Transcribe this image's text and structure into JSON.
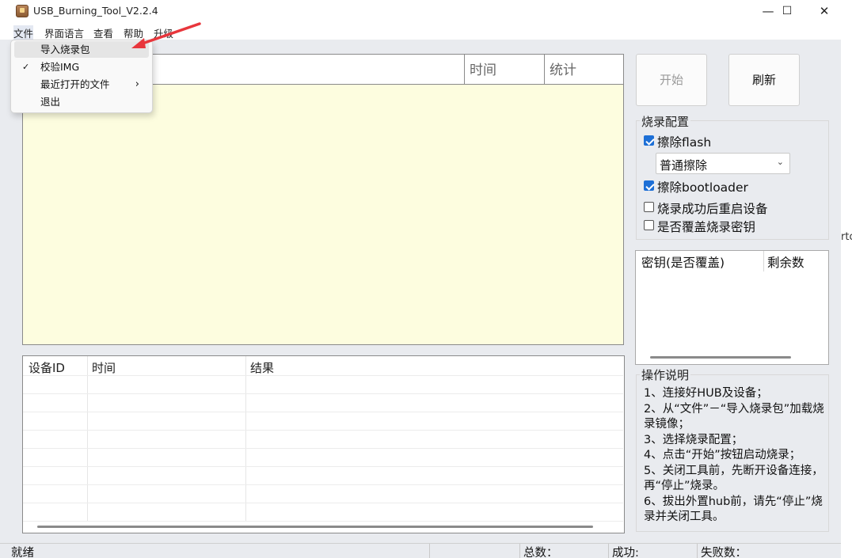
{
  "window": {
    "title": "USB_Burning_Tool_V2.2.4",
    "controls": [
      "—",
      "☐",
      "✕"
    ]
  },
  "menubar": {
    "items": [
      "文件",
      "界面语言",
      "查看",
      "帮助",
      "升级"
    ]
  },
  "file_menu": {
    "items": [
      {
        "label": "导入烧录包",
        "checked": false,
        "submenu": false
      },
      {
        "label": "校验IMG",
        "checked": true,
        "submenu": false
      },
      {
        "label": "最近打开的文件",
        "checked": false,
        "submenu": true
      },
      {
        "label": "退出",
        "checked": false,
        "submenu": false
      }
    ],
    "check_mark": "✓",
    "submenu_arrow": "›"
  },
  "log_panel": {
    "columns": [
      "时间",
      "统计"
    ]
  },
  "device_table": {
    "columns": [
      "设备ID",
      "时间",
      "结果"
    ]
  },
  "buttons": {
    "start": "开始",
    "refresh": "刷新"
  },
  "burn_config": {
    "title": "烧录配置",
    "erase_flash": {
      "label": "擦除flash",
      "checked": true
    },
    "erase_mode": "普通擦除",
    "erase_bootloader": {
      "label": "擦除bootloader",
      "checked": true
    },
    "reboot_after": {
      "label": "烧录成功后重启设备",
      "checked": false
    },
    "overwrite_key": {
      "label": "是否覆盖烧录密钥",
      "checked": false
    }
  },
  "key_table": {
    "columns": [
      "密钥(是否覆盖)",
      "剩余数"
    ]
  },
  "instructions": {
    "title": "操作说明",
    "lines": [
      "1、连接好HUB及设备；",
      "2、从“文件”－“导入烧录包”加载烧录镜像；",
      "3、选择烧录配置；",
      "4、点击“开始”按钮启动烧录；",
      "5、关闭工具前，先断开设备连接，再“停止”烧录。",
      "6、拔出外置hub前，请先“停止”烧录并关闭工具。"
    ]
  },
  "status_bar": {
    "status": "就绪",
    "total": "总数：",
    "success": "成功:",
    "fail": "失败数："
  },
  "side_clip_text": "rto",
  "colors": {
    "annotation_arrow": "#e8363c",
    "checkbox_accent": "#1d6fd6",
    "log_background": "#fdfddf"
  }
}
